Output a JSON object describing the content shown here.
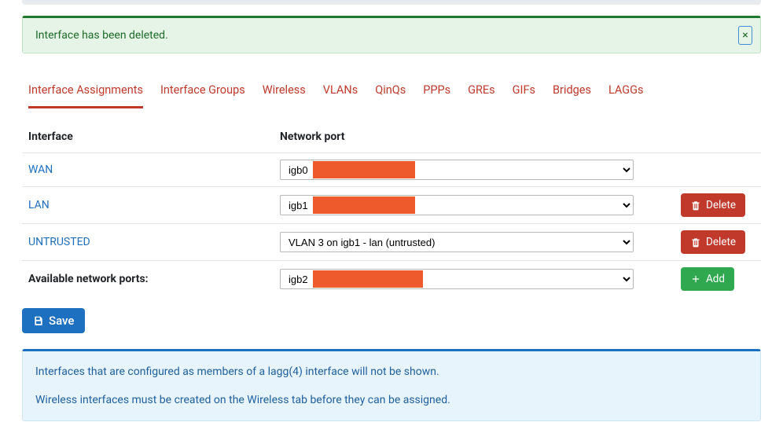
{
  "alert": {
    "message": "Interface has been deleted."
  },
  "tabs": [
    "Interface Assignments",
    "Interface Groups",
    "Wireless",
    "VLANs",
    "QinQs",
    "PPPs",
    "GREs",
    "GIFs",
    "Bridges",
    "LAGGs"
  ],
  "headers": {
    "interface": "Interface",
    "port": "Network port"
  },
  "rows": [
    {
      "label": "WAN",
      "port": "igb0",
      "masked": true,
      "action": null
    },
    {
      "label": "LAN",
      "port": "igb1",
      "masked": true,
      "action": "delete"
    },
    {
      "label": "UNTRUSTED",
      "port": "VLAN 3 on igb1 - lan (untrusted)",
      "masked": false,
      "action": "delete"
    }
  ],
  "available": {
    "label": "Available network ports:",
    "port": "igb2",
    "masked": true
  },
  "buttons": {
    "delete": "Delete",
    "add": "Add",
    "save": "Save"
  },
  "info": {
    "line1": "Interfaces that are configured as members of a lagg(4) interface will not be shown.",
    "line2": "Wireless interfaces must be created on the Wireless tab before they can be assigned."
  }
}
